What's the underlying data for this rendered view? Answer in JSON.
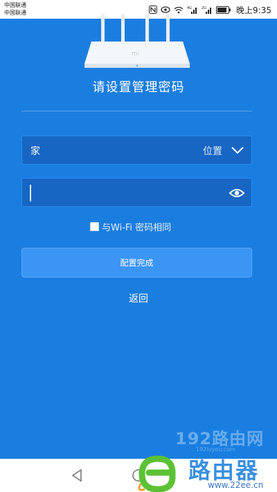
{
  "status_bar": {
    "carrier_1": "中国联通",
    "carrier_2": "中国联通",
    "time": "晚上9:35",
    "icons": [
      "nfc-icon",
      "eye-icon",
      "wifi-icon",
      "signal-4g-icon",
      "signal-2g-icon",
      "battery-icon"
    ]
  },
  "header": {
    "title": "请设置管理密码"
  },
  "location_field": {
    "value": "家",
    "label": "位置"
  },
  "password_field": {
    "value": ""
  },
  "same_as_wifi": {
    "label": "与Wi-Fi 密码相同",
    "checked": false
  },
  "finish_button": {
    "label": "配置完成"
  },
  "back_link": {
    "label": "返回"
  },
  "watermark": {
    "site_top": "192路由网",
    "site_sub": "192luyou.com",
    "brand": "路由器",
    "domain": "www.22ee.cn"
  },
  "colors": {
    "background": "#1a7ee0",
    "field": "#1766c4",
    "button": "#3b95f5"
  }
}
